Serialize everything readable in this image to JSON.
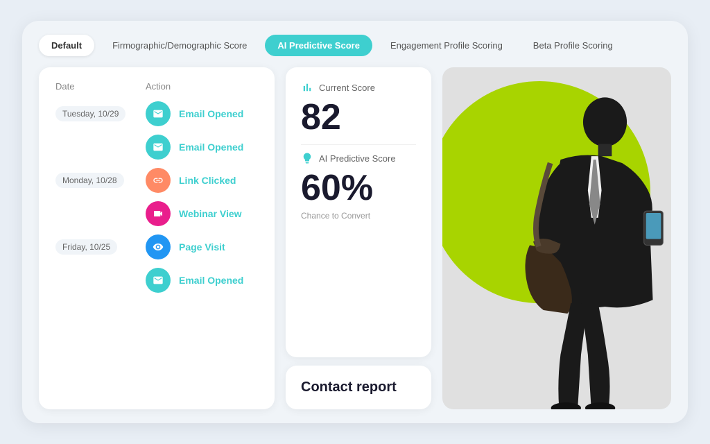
{
  "tabs": [
    {
      "id": "default",
      "label": "Default",
      "active": false,
      "selected": false
    },
    {
      "id": "firmographic",
      "label": "Firmographic/Demographic Score",
      "active": false
    },
    {
      "id": "ai-predictive",
      "label": "AI Predictive Score",
      "active": true
    },
    {
      "id": "engagement",
      "label": "Engagement Profile Scoring",
      "active": false
    },
    {
      "id": "beta",
      "label": "Beta Profile Scoring",
      "active": false
    }
  ],
  "activity": {
    "col_date": "Date",
    "col_action": "Action",
    "rows": [
      {
        "date": "Tuesday, 10/29",
        "icon": "email",
        "color": "teal",
        "label": "Email Opened"
      },
      {
        "date": "",
        "icon": "email",
        "color": "teal",
        "label": "Email Opened"
      },
      {
        "date": "Monday, 10/28",
        "icon": "link",
        "color": "orange",
        "label": "Link Clicked"
      },
      {
        "date": "",
        "icon": "webinar",
        "color": "pink",
        "label": "Webinar View"
      },
      {
        "date": "Friday, 10/25",
        "icon": "page",
        "color": "blue",
        "label": "Page Visit"
      },
      {
        "date": "",
        "icon": "email",
        "color": "teal",
        "label": "Email Opened"
      }
    ]
  },
  "current_score": {
    "label": "Current Score",
    "value": "82"
  },
  "predictive_score": {
    "label": "AI Predictive Score",
    "value": "60%",
    "sub": "Chance to Convert"
  },
  "contact_report": {
    "label": "Contact report"
  },
  "colors": {
    "teal": "#3ecfcf",
    "orange": "#ff8a65",
    "pink": "#e91e8c",
    "blue": "#2196f3",
    "green_circle": "#a8d400"
  }
}
